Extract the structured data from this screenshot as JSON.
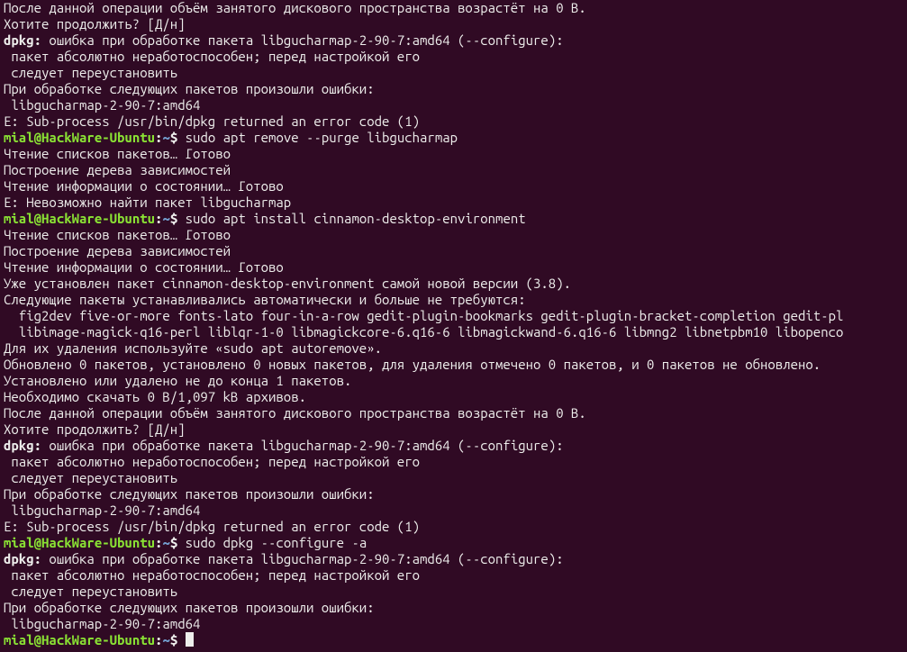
{
  "prompt": {
    "user": "mial",
    "at": "@",
    "host": "HackWare-Ubuntu",
    "colon": ":",
    "path": "~",
    "dollar": "$ "
  },
  "lines": [
    {
      "t": "plain",
      "text": "После данной операции объём занятого дискового пространства возрастёт на 0 B."
    },
    {
      "t": "plain",
      "text": "Хотите продолжить? [Д/н] "
    },
    {
      "t": "dpkg",
      "pre": "dpkg:",
      "text": " ошибка при обработке пакета libgucharmap-2-90-7:amd64 (--configure):"
    },
    {
      "t": "plain",
      "text": " пакет абсолютно неработоспособен; перед настройкой его"
    },
    {
      "t": "plain",
      "text": " следует переустановить"
    },
    {
      "t": "plain",
      "text": "При обработке следующих пакетов произошли ошибки:"
    },
    {
      "t": "plain",
      "text": " libgucharmap-2-90-7:amd64"
    },
    {
      "t": "plain",
      "text": "E: Sub-process /usr/bin/dpkg returned an error code (1)"
    },
    {
      "t": "prompt",
      "cmd": "sudo apt remove --purge libgucharmap"
    },
    {
      "t": "plain",
      "text": "Чтение списков пакетов… Готово"
    },
    {
      "t": "plain",
      "text": "Построение дерева зависимостей       "
    },
    {
      "t": "plain",
      "text": "Чтение информации о состоянии… Готово"
    },
    {
      "t": "plain",
      "text": "E: Невозможно найти пакет libgucharmap"
    },
    {
      "t": "prompt",
      "cmd": "sudo apt install cinnamon-desktop-environment"
    },
    {
      "t": "plain",
      "text": "Чтение списков пакетов… Готово"
    },
    {
      "t": "plain",
      "text": "Построение дерева зависимостей       "
    },
    {
      "t": "plain",
      "text": "Чтение информации о состоянии… Готово"
    },
    {
      "t": "plain",
      "text": "Уже установлен пакет cinnamon-desktop-environment самой новой версии (3.8)."
    },
    {
      "t": "plain",
      "text": "Следующие пакеты устанавливались автоматически и больше не требуются:"
    },
    {
      "t": "plain",
      "text": "  fig2dev five-or-more fonts-lato four-in-a-row gedit-plugin-bookmarks gedit-plugin-bracket-completion gedit-pl"
    },
    {
      "t": "plain",
      "text": "  libimage-magick-q16-perl liblqr-1-0 libmagickcore-6.q16-6 libmagickwand-6.q16-6 libmng2 libnetpbm10 libopenco"
    },
    {
      "t": "plain",
      "text": "Для их удаления используйте «sudo apt autoremove»."
    },
    {
      "t": "plain",
      "text": "Обновлено 0 пакетов, установлено 0 новых пакетов, для удаления отмечено 0 пакетов, и 0 пакетов не обновлено."
    },
    {
      "t": "plain",
      "text": "Установлено или удалено не до конца 1 пакетов."
    },
    {
      "t": "plain",
      "text": "Необходимо скачать 0 B/1,097 kB архивов."
    },
    {
      "t": "plain",
      "text": "После данной операции объём занятого дискового пространства возрастёт на 0 B."
    },
    {
      "t": "plain",
      "text": "Хотите продолжить? [Д/н] "
    },
    {
      "t": "dpkg",
      "pre": "dpkg:",
      "text": " ошибка при обработке пакета libgucharmap-2-90-7:amd64 (--configure):"
    },
    {
      "t": "plain",
      "text": " пакет абсолютно неработоспособен; перед настройкой его"
    },
    {
      "t": "plain",
      "text": " следует переустановить"
    },
    {
      "t": "plain",
      "text": "При обработке следующих пакетов произошли ошибки:"
    },
    {
      "t": "plain",
      "text": " libgucharmap-2-90-7:amd64"
    },
    {
      "t": "plain",
      "text": "E: Sub-process /usr/bin/dpkg returned an error code (1)"
    },
    {
      "t": "prompt",
      "cmd": "sudo dpkg --configure -a"
    },
    {
      "t": "dpkg",
      "pre": "dpkg:",
      "text": " ошибка при обработке пакета libgucharmap-2-90-7:amd64 (--configure):"
    },
    {
      "t": "plain",
      "text": " пакет абсолютно неработоспособен; перед настройкой его"
    },
    {
      "t": "plain",
      "text": " следует переустановить"
    },
    {
      "t": "plain",
      "text": "При обработке следующих пакетов произошли ошибки:"
    },
    {
      "t": "plain",
      "text": " libgucharmap-2-90-7:amd64"
    },
    {
      "t": "prompt",
      "cmd": "",
      "cursor": true
    }
  ]
}
